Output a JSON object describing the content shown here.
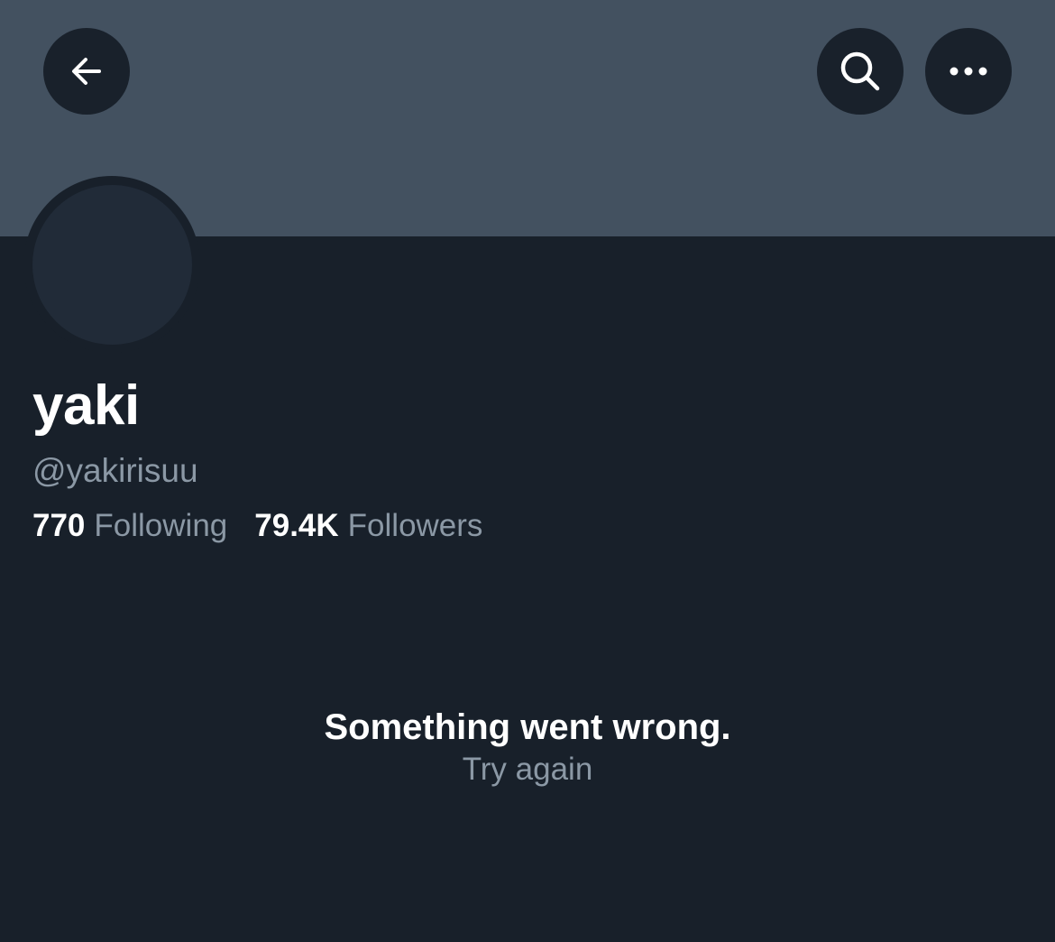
{
  "header": {
    "back_icon": "arrow-left-icon",
    "search_icon": "search-icon",
    "more_icon": "more-horizontal-icon",
    "banner_color": "#435160",
    "button_color": "#19212b"
  },
  "profile": {
    "display_name": "yaki",
    "handle": "@yakirisuu",
    "following_count": "770",
    "following_label": "Following",
    "followers_count": "79.4K",
    "followers_label": "Followers"
  },
  "error": {
    "title": "Something went wrong.",
    "retry_label": "Try again"
  },
  "theme": {
    "background": "#18202a",
    "text_primary": "#ffffff",
    "text_secondary": "#8b98a5"
  }
}
